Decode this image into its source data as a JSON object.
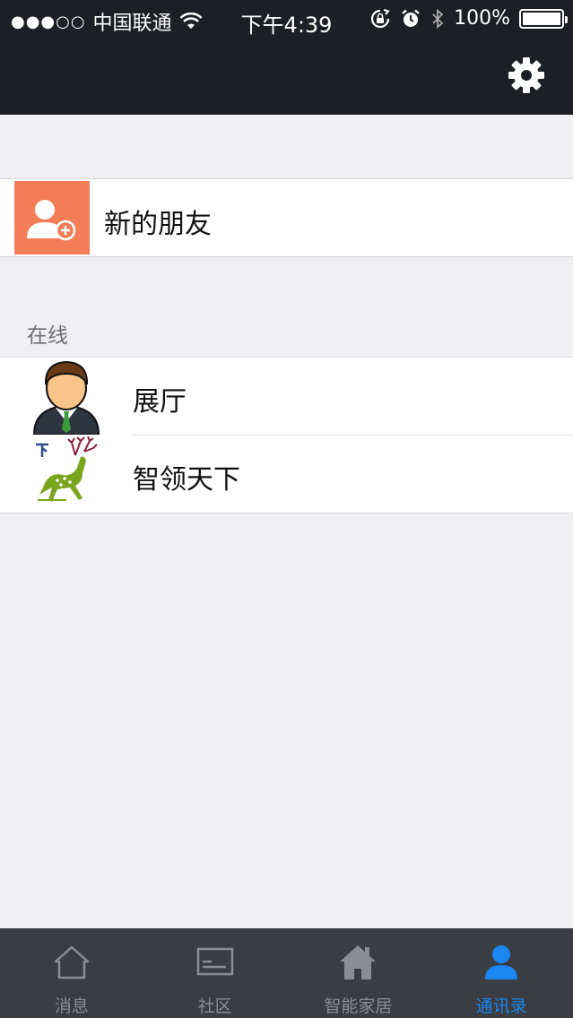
{
  "status_bar": {
    "signal": "●●●○○",
    "carrier": "中国联通",
    "time": "下午4:39",
    "battery": "100%"
  },
  "header": {
    "settings_icon": "gear-icon"
  },
  "new_friends": {
    "label": "新的朋友",
    "icon": "add-user-icon",
    "icon_bg": "#f27d56"
  },
  "online_section": {
    "title": "在线",
    "contacts": [
      {
        "name": "展厅",
        "avatar": "businessman-avatar"
      },
      {
        "name": "智领天下",
        "avatar": "deer-logo-avatar"
      }
    ]
  },
  "tab_bar": {
    "active_color": "#1b86f2",
    "tabs": [
      {
        "label": "消息",
        "icon": "home-outline-icon"
      },
      {
        "label": "社区",
        "icon": "community-board-icon"
      },
      {
        "label": "智能家居",
        "icon": "house-icon"
      },
      {
        "label": "通讯录",
        "icon": "contacts-person-icon"
      }
    ]
  }
}
